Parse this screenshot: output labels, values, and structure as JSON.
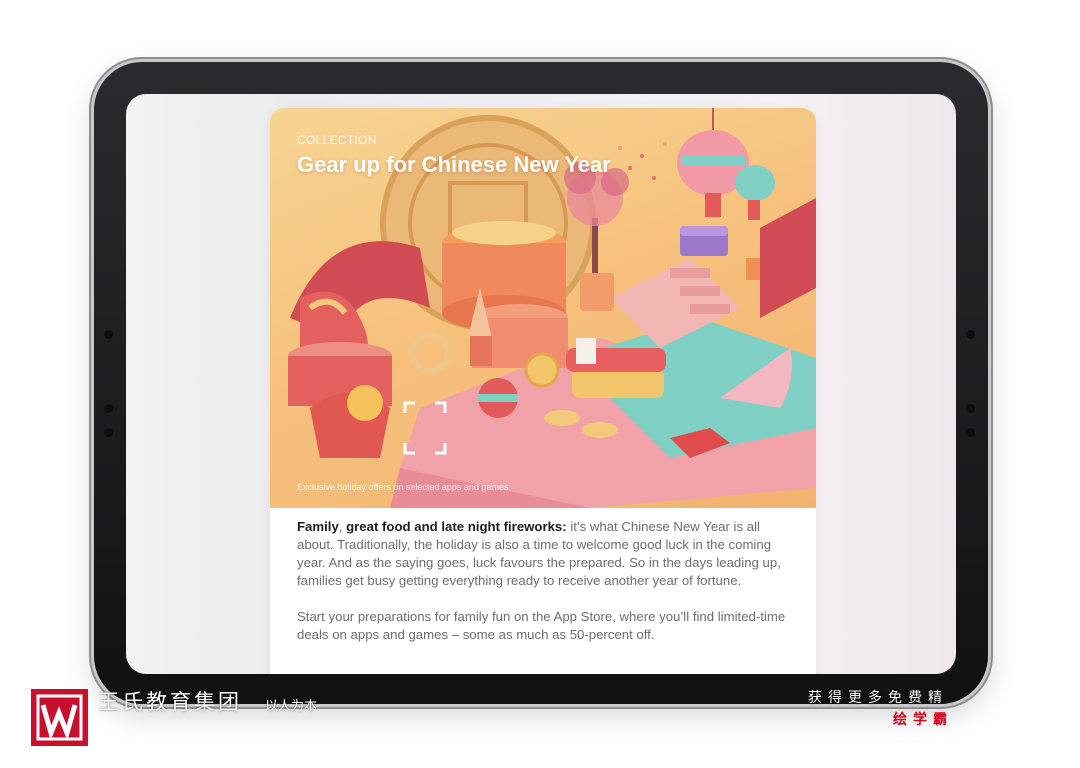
{
  "story_card": {
    "eyebrow": "COLLECTION",
    "title": "Gear up for Chinese New Year",
    "caption": "Exclusive holiday offers on selected apps and games",
    "paragraph1": {
      "bold_a": "Family",
      "sep": ", ",
      "bold_b": "great food and late night fireworks:",
      "rest": " it’s what Chinese New Year is all about. Traditionally, the holiday is also a time to welcome good luck in the coming year. And as the saying goes, luck favours the prepared. So in the days leading up, families get busy getting everything ready to receive another year of fortune."
    },
    "paragraph2": "Start your preparations for family fun on the App Store, where you’ll find limited-time deals on apps and games – some as much as 50-percent off."
  },
  "branding": {
    "name": "王氏教育集团",
    "slogan": "以人为本",
    "promo_line": "获得更多免费精",
    "promo_brand": "绘学霸",
    "logo_color": "#c8102e",
    "accent_color": "#d0021b"
  },
  "icons": {
    "logo": "w-logo-icon",
    "hero": "chinese-new-year-scene-illustration"
  }
}
